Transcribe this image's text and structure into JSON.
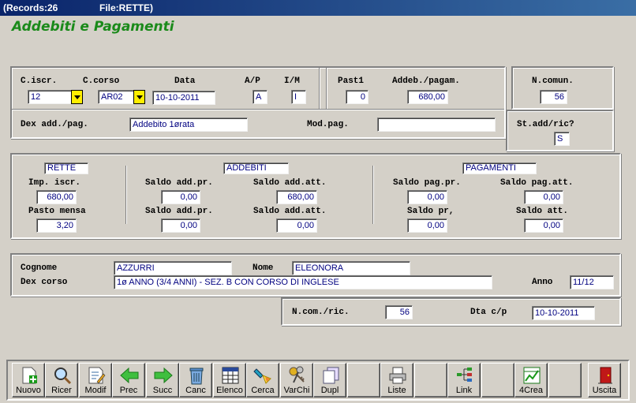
{
  "titlebar": {
    "records": "(Records:26",
    "file": "File:RETTE)"
  },
  "app": {
    "title": "Addebiti e Pagamenti"
  },
  "top": {
    "c_iscr_label": "C.iscr.",
    "c_iscr_value": "12",
    "c_corso_label": "C.corso",
    "c_corso_value": "AR02",
    "data_label": "Data",
    "data_value": "10-10-2011",
    "ap_label": "A/P",
    "ap_value": "A",
    "im_label": "I/M",
    "im_value": "I",
    "dex_label": "Dex add./pag.",
    "dex_value": "Addebito 1ørata",
    "modpag_label": "Mod.pag.",
    "modpag_value": "",
    "past1_label": "Past1",
    "past1_value": "0",
    "addeb_label": "Addeb./pagam.",
    "addeb_value": "680,00",
    "ncomun_label": "N.comun.",
    "ncomun_value": "56",
    "stadd_label": "St.add/ric?",
    "stadd_value": "S"
  },
  "saldi": {
    "rette_title": "RETTE",
    "imp_iscr_label": "Imp. iscr.",
    "imp_iscr_value": "680,00",
    "pasto_label": "Pasto mensa",
    "pasto_value": "3,20",
    "addebiti_title": "ADDEBITI",
    "saldo_add_pr_label": "Saldo add.pr.",
    "saldo_add_pr_value": "0,00",
    "saldo_add_att_label": "Saldo add.att.",
    "saldo_add_att_value": "680,00",
    "saldo_add_pr2_label": "Saldo add.pr.",
    "saldo_add_pr2_value": "0,00",
    "saldo_add_att2_label": "Saldo add.att.",
    "saldo_add_att2_value": "0,00",
    "pagamenti_title": "PAGAMENTI",
    "saldo_pag_pr_label": "Saldo pag.pr.",
    "saldo_pag_pr_value": "0,00",
    "saldo_pag_att_label": "Saldo pag.att.",
    "saldo_pag_att_value": "0,00",
    "saldo_pr_label": "Saldo pr,",
    "saldo_pr_value": "0,00",
    "saldo_att_label": "Saldo att.",
    "saldo_att_value": "0,00"
  },
  "student": {
    "cognome_label": "Cognome",
    "cognome_value": "AZZURRI",
    "nome_label": "Nome",
    "nome_value": "ELEONORA",
    "dexcorso_label": "Dex corso",
    "dexcorso_value": "1ø ANNO (3/4 ANNI) - SEZ. B CON CORSO DI INGLESE",
    "anno_label": "Anno",
    "anno_value": "11/12"
  },
  "comm": {
    "ncom_label": "N.com./ric.",
    "ncom_value": "56",
    "dta_label": "Dta c/p",
    "dta_value": "10-10-2011"
  },
  "toolbar": {
    "nuovo": "Nuovo",
    "ricer": "Ricer",
    "modif": "Modif",
    "prec": "Prec",
    "succ": "Succ",
    "canc": "Canc",
    "elenco": "Elenco",
    "cerca": "Cerca",
    "varchi": "VarChi",
    "dupl": "Dupl",
    "liste": "Liste",
    "link": "Link",
    "crea4": "4Crea",
    "uscita": "Uscita"
  }
}
